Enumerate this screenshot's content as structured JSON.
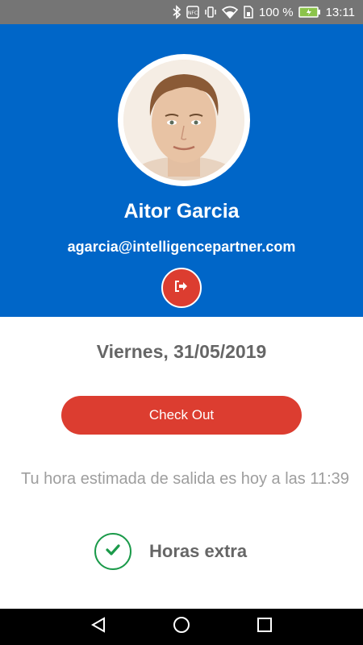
{
  "status_bar": {
    "battery_text": "100 %",
    "time": "13:11",
    "icons": [
      "bluetooth-icon",
      "nfc-icon",
      "vibrate-icon",
      "wifi-icon",
      "sim-icon",
      "battery-icon"
    ]
  },
  "profile": {
    "name": "Aitor Garcia",
    "email": "agarcia@intelligencepartner.com",
    "logout_icon": "logout-icon"
  },
  "main": {
    "date": "Viernes, 31/05/2019",
    "checkout_label": "Check Out",
    "estimate_text": "Tu hora estimada de salida es hoy a las 11:39",
    "extra_hours_label": "Horas extra",
    "extra_hours_checked": true
  },
  "nav_bar": {
    "buttons": [
      "back-icon",
      "home-icon",
      "recents-icon"
    ]
  },
  "colors": {
    "header": "#0066c8",
    "accent_red": "#dc3d30",
    "check_green": "#1b9a4a",
    "status_bar": "#757575"
  }
}
